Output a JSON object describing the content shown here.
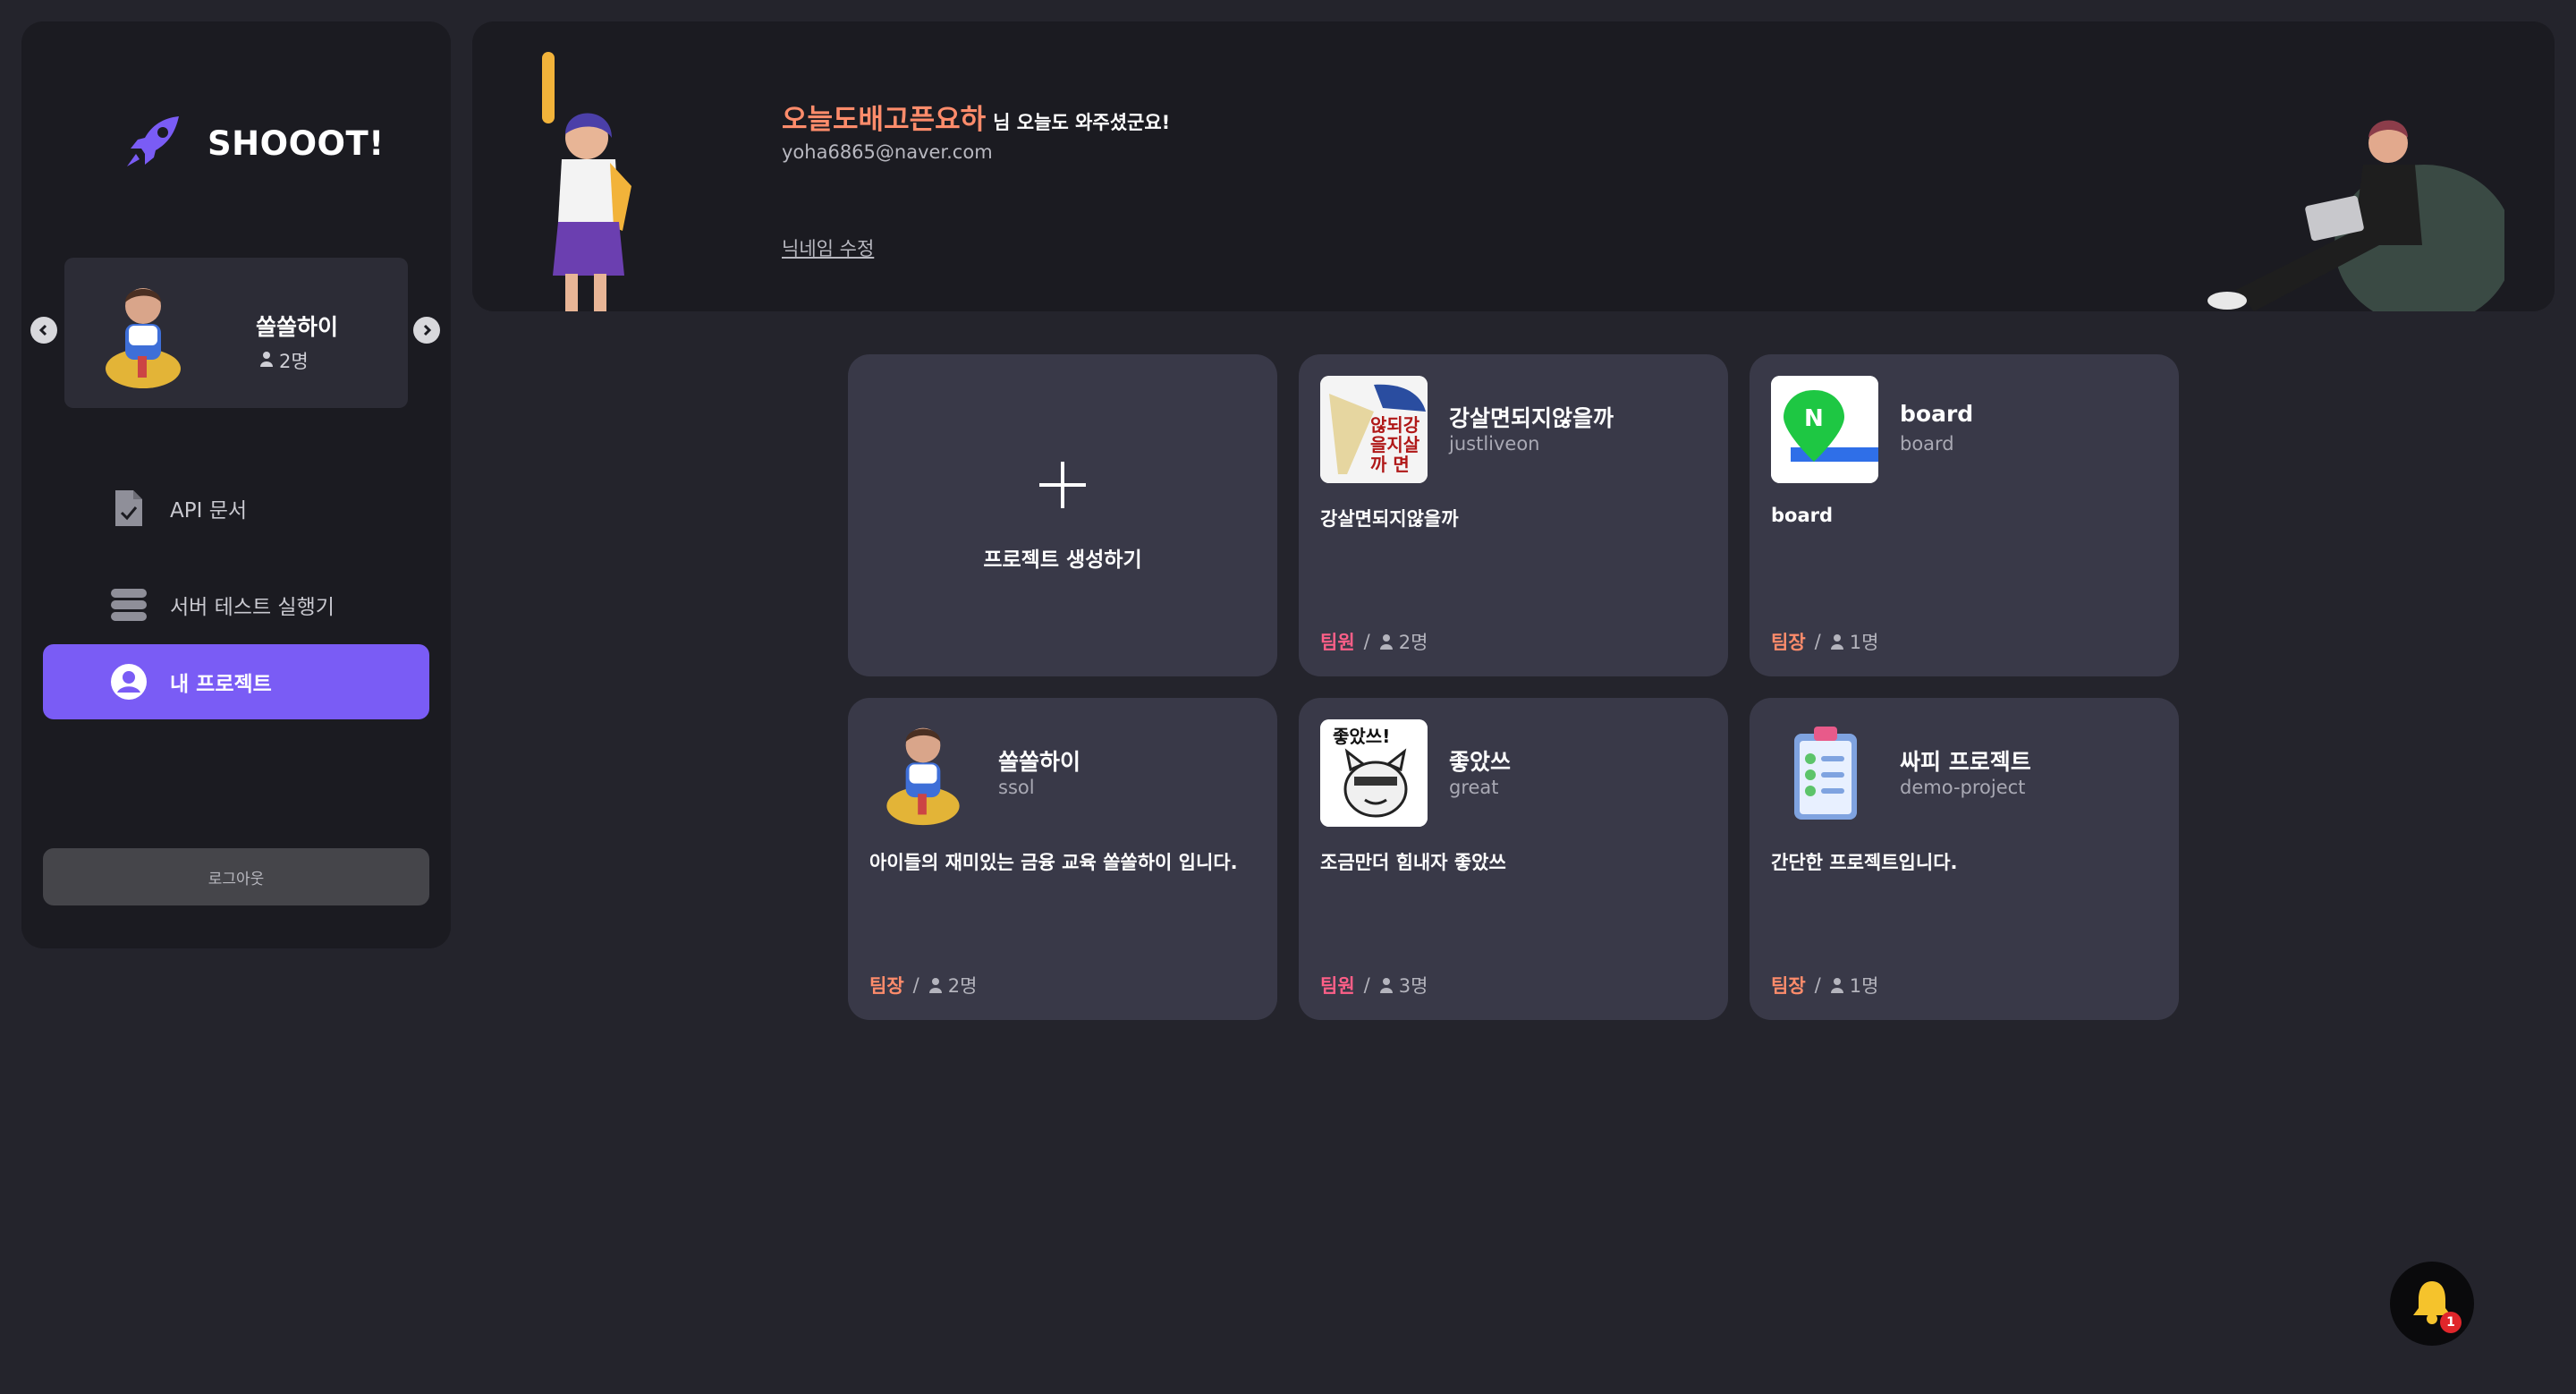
{
  "app": {
    "brand": "SHOOOT!"
  },
  "sidebar": {
    "current_project": {
      "name": "쏠쏠하이",
      "members": "2명"
    },
    "menu": [
      {
        "label": "API 문서",
        "icon": "document-check-icon"
      },
      {
        "label": "서버 테스트 실행기",
        "icon": "server-icon"
      },
      {
        "label": "내 프로젝트",
        "icon": "user-circle-icon",
        "active": true
      }
    ],
    "logout_label": "로그아웃"
  },
  "banner": {
    "nickname": "오늘도배고픈요하",
    "greeting_suffix": "님 오늘도 와주셨군요!",
    "email": "yoha6865@naver.com",
    "edit_nickname": "닉네임 수정"
  },
  "projects": {
    "create_label": "프로젝트 생성하기",
    "items": [
      {
        "title": "강살면되지않을까",
        "sub": "justliveon",
        "desc": "강살면되지않을까",
        "role": "팀원",
        "members": "2명",
        "thumb": "calligraphy-image"
      },
      {
        "title": "board",
        "sub": "board",
        "desc": "board",
        "role": "팀장",
        "members": "1명",
        "thumb": "naver-map-icon"
      },
      {
        "title": "쏠쏠하이",
        "sub": "ssol",
        "desc": "아이들의 재미있는 금융 교육 쏠쏠하이 입니다.",
        "role": "팀장",
        "members": "2명",
        "thumb": "boy-avatar"
      },
      {
        "title": "좋았쓰",
        "sub": "great",
        "desc": "조금만더 힘내자 좋았쓰",
        "role": "팀원",
        "members": "3명",
        "thumb": "cat-meme-image"
      },
      {
        "title": "싸피 프로젝트",
        "sub": "demo-project",
        "desc": "간단한 프로젝트입니다.",
        "role": "팀장",
        "members": "1명",
        "thumb": "clipboard-icon"
      }
    ],
    "separator": "/"
  },
  "notification": {
    "count": "1"
  },
  "colors": {
    "accent": "#7a5cf5",
    "leader": "#ff8c6b",
    "member": "#ff5f88",
    "card": "#393948",
    "panel": "#1b1b21"
  }
}
